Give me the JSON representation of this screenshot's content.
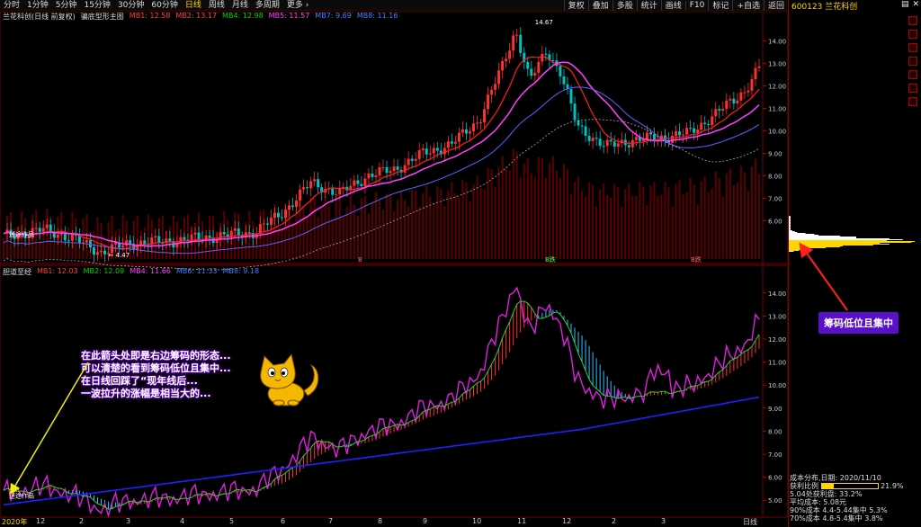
{
  "toolbar": {
    "tabs": [
      "分时",
      "1分钟",
      "5分钟",
      "15分钟",
      "30分钟",
      "60分钟",
      "日线",
      "周线",
      "月线",
      "多周期",
      "更多 ›"
    ],
    "active_tab": "日线",
    "tools": [
      "复权",
      "叠加",
      "多股",
      "统计",
      "画线",
      "F10",
      "标记",
      "+自选",
      "返回"
    ]
  },
  "stock_header": {
    "code_name": "600123 兰花科创"
  },
  "upper_chart": {
    "title": "兰花科创(日线 前复权)",
    "indicator": "骗底型形主图",
    "legend": [
      {
        "label": "MB1: 12.58",
        "color": "#ff4040"
      },
      {
        "label": "MB2: 13.17",
        "color": "#ff4040"
      },
      {
        "label": "MB4: 12.98",
        "color": "#00d000"
      },
      {
        "label": "MB5: 11.57",
        "color": "#ff40ff"
      },
      {
        "label": "MB7: 9.69",
        "color": "#4080ff"
      },
      {
        "label": "MB8: 11.16",
        "color": "#4080ff"
      }
    ],
    "y_ticks": [
      "14.00",
      "13.00",
      "12.00",
      "11.00",
      "10.00",
      "9.00",
      "8.00",
      "7.00",
      "6.00"
    ],
    "high_label": "14.67",
    "low_label": "4.47",
    "left_text": "迷途作品",
    "signals": [
      "B",
      "B跌",
      "B跌"
    ]
  },
  "lower_chart": {
    "title": "胆道至经",
    "legend": [
      {
        "label": "MB1: 12.03",
        "color": "#ff4040"
      },
      {
        "label": "MB2: 12.09",
        "color": "#00d000"
      },
      {
        "label": "MB4: 11.66",
        "color": "#ff40ff"
      },
      {
        "label": "MB6: 11.33",
        "color": "#4080ff"
      },
      {
        "label": "MB8: 9.18",
        "color": "#4080ff"
      }
    ],
    "y_ticks": [
      "14.00",
      "13.00",
      "12.00",
      "11.00",
      "10.00",
      "9.00",
      "8.00",
      "7.00",
      "6.00",
      "5.00"
    ],
    "left_text": "迷途作品"
  },
  "x_axis": {
    "year_label": "2020年",
    "months": [
      "12",
      "2",
      "3",
      "4",
      "5",
      "6",
      "7",
      "8",
      "9",
      "10",
      "11",
      "12",
      "2",
      "3"
    ],
    "period_label": "日线"
  },
  "annotations": {
    "text_lines": [
      "在此箭头处即是右边筹码的形态...",
      "可以清楚的看到筹码低位且集中...",
      "在日线回踩了“现年线后...",
      "一波拉升的涨幅是相当大的..."
    ],
    "callout": "筹码低位且集中"
  },
  "chip_distribution": {
    "date_label": "成本分布,日期: 2020/11/10",
    "profit_label": "获利比例",
    "profit_value": "21.9%",
    "profit_fraction": 0.219,
    "profit_at_price": "5.04处获利盘: 33.2%",
    "avg_cost": "平均成本: 5.08元",
    "cost_90": "90%成本 4.4-5.44集中 5.3%",
    "cost_70": "70%成本 4.8-5.4集中 3.8%"
  },
  "colors": {
    "up": "#ff3030",
    "down": "#00c0c0",
    "ma_pink": "#ff40ff",
    "ma_blue": "#2020ff",
    "annotation_bg": "#5a0fc8",
    "accent": "#ffd700"
  }
}
